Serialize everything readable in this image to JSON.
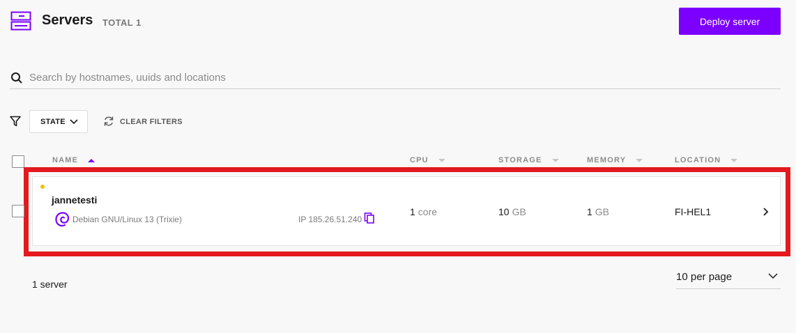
{
  "header": {
    "title": "Servers",
    "total_label": "TOTAL",
    "total_count": "1",
    "deploy_label": "Deploy server"
  },
  "search": {
    "placeholder": "Search by hostnames, uuids and locations",
    "value": ""
  },
  "filters": {
    "state_label": "STATE",
    "clear_label": "CLEAR FILTERS"
  },
  "table": {
    "columns": {
      "name": "NAME",
      "cpu": "CPU",
      "storage": "STORAGE",
      "memory": "MEMORY",
      "location": "LOCATION"
    },
    "sort": {
      "column": "name",
      "direction": "ascending"
    },
    "rows": [
      {
        "hostname": "jannetesti",
        "state_color": "#f4c100",
        "os": "Debian GNU/Linux 13 (Trixie)",
        "os_icon": "debian-logo-icon",
        "ip": "IP 185.26.51.240",
        "cpu_value": "1",
        "cpu_unit": "core",
        "storage_value": "10",
        "storage_unit": "GB",
        "memory_value": "1",
        "memory_unit": "GB",
        "location": "FI-HEL1"
      }
    ]
  },
  "footer": {
    "count_label": "1 server",
    "per_page_label": "10 per page"
  },
  "colors": {
    "accent": "#7b00ff",
    "highlight": "#e3191d",
    "status_pending": "#f4c100",
    "background": "#f8f8f8"
  },
  "icons": [
    "servers-icon",
    "search-icon",
    "filter-icon",
    "chevron-down-icon",
    "refresh-icon",
    "debian-logo-icon",
    "copy-icon",
    "chevron-right-icon"
  ]
}
